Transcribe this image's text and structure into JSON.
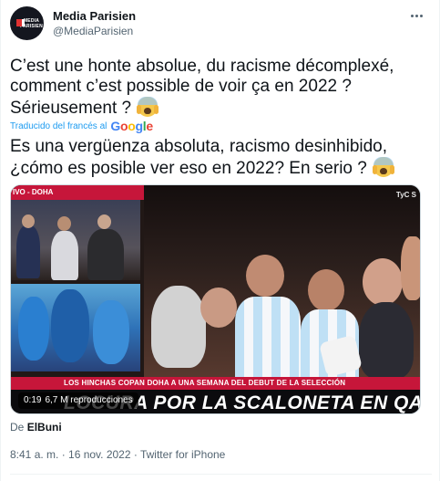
{
  "author": {
    "name": "Media Parisien",
    "handle": "@MediaParisien",
    "avatar_text_1": "MEDIA",
    "avatar_text_2": "PARISIEN"
  },
  "tweet": {
    "text_line1": "C’est une honte absolue, du racisme décomplexé,",
    "text_line2": "comment c’est possible de voir ça en 2022 ?",
    "text_line3": "Sérieusement ?",
    "translated_by": "Traducido del francés al",
    "translation_line1": "Es una vergüenza absoluta, racismo desinhibido,",
    "translation_line2": "¿cómo es posible ver eso en 2022? En serio ?"
  },
  "media": {
    "live_tag": "IVO - DOHA",
    "channel_logo": "TyC S",
    "lower_third": "LOS HINCHAS COPAN DOHA A UNA SEMANA DEL DEBUT DE LA SELECCIÓN",
    "headline": "LOCURA POR LA SCALONETA EN QATA",
    "duration": "0:19",
    "views": "6,7 M reproducciones",
    "mic_label": "TyC Sports"
  },
  "source": {
    "prefix": "De",
    "account": "ElBuni"
  },
  "meta": {
    "timestamp": "8:41 a. m. · 16 nov. 2022 · Twitter for iPhone"
  },
  "icons": {
    "more": "more-dots-icon",
    "emoji": "screaming-face-emoji-icon"
  }
}
